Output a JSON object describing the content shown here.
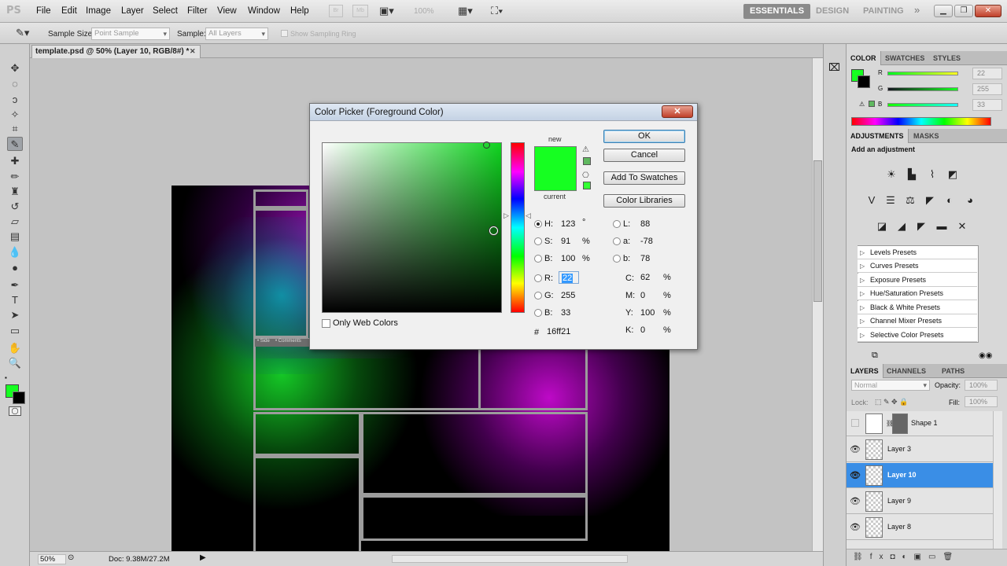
{
  "app": {
    "logo": "PS"
  },
  "menu": [
    "File",
    "Edit",
    "Image",
    "Layer",
    "Select",
    "Filter",
    "View",
    "Window",
    "Help"
  ],
  "menu_icons": {
    "zoom_label": "100%"
  },
  "workspaces": [
    "ESSENTIALS",
    "DESIGN",
    "PAINTING"
  ],
  "options_bar": {
    "sample_size_label": "Sample Size:",
    "sample_size_value": "Point Sample",
    "sample_label": "Sample:",
    "sample_value": "All Layers",
    "show_ring_label": "Show Sampling Ring"
  },
  "document": {
    "tab_title": "template.psd @ 50% (Layer 10, RGB/8#) *",
    "canvas_text_1": "• Side",
    "canvas_text_2": "• Comments"
  },
  "status": {
    "zoom": "50%",
    "doc": "Doc: 9.38M/27.2M"
  },
  "color_picker": {
    "title": "Color Picker (Foreground Color)",
    "new_label": "new",
    "current_label": "current",
    "new_color": "#16ff21",
    "current_color": "#16ff21",
    "buttons": {
      "ok": "OK",
      "cancel": "Cancel",
      "add_swatches": "Add To Swatches",
      "libraries": "Color Libraries"
    },
    "only_web_colors": "Only Web Colors",
    "fields": {
      "H": {
        "label": "H:",
        "value": "123",
        "unit": "°"
      },
      "S": {
        "label": "S:",
        "value": "91",
        "unit": "%"
      },
      "Bv": {
        "label": "B:",
        "value": "100",
        "unit": "%"
      },
      "R": {
        "label": "R:",
        "value": "22"
      },
      "G": {
        "label": "G:",
        "value": "255"
      },
      "Bc": {
        "label": "B:",
        "value": "33"
      },
      "L": {
        "label": "L:",
        "value": "88"
      },
      "a": {
        "label": "a:",
        "value": "-78"
      },
      "b": {
        "label": "b:",
        "value": "78"
      },
      "C": {
        "label": "C:",
        "value": "62",
        "unit": "%"
      },
      "M": {
        "label": "M:",
        "value": "0",
        "unit": "%"
      },
      "Y": {
        "label": "Y:",
        "value": "100",
        "unit": "%"
      },
      "K": {
        "label": "K:",
        "value": "0",
        "unit": "%"
      },
      "hex": {
        "label": "#",
        "value": "16ff21"
      }
    }
  },
  "color_panel": {
    "tabs": [
      "COLOR",
      "SWATCHES",
      "STYLES"
    ],
    "R": {
      "label": "R",
      "value": "22"
    },
    "G": {
      "label": "G",
      "value": "255"
    },
    "B": {
      "label": "B",
      "value": "33"
    },
    "fg": "#16ff21",
    "bg": "#000000"
  },
  "adjustments_panel": {
    "tabs": [
      "ADJUSTMENTS",
      "MASKS"
    ],
    "heading": "Add an adjustment",
    "presets": [
      "Levels Presets",
      "Curves Presets",
      "Exposure Presets",
      "Hue/Saturation Presets",
      "Black & White Presets",
      "Channel Mixer Presets",
      "Selective Color Presets"
    ]
  },
  "layers_panel": {
    "tabs": [
      "LAYERS",
      "CHANNELS",
      "PATHS"
    ],
    "blend_mode": "Normal",
    "opacity_label": "Opacity:",
    "opacity_value": "100%",
    "fill_label": "Fill:",
    "fill_value": "100%",
    "lock_label": "Lock:",
    "layers": [
      {
        "name": "Shape 1",
        "visible": false
      },
      {
        "name": "Layer 3",
        "visible": true
      },
      {
        "name": "Layer 10",
        "visible": true,
        "selected": true
      },
      {
        "name": "Layer 9",
        "visible": true
      },
      {
        "name": "Layer 8",
        "visible": true
      }
    ]
  }
}
